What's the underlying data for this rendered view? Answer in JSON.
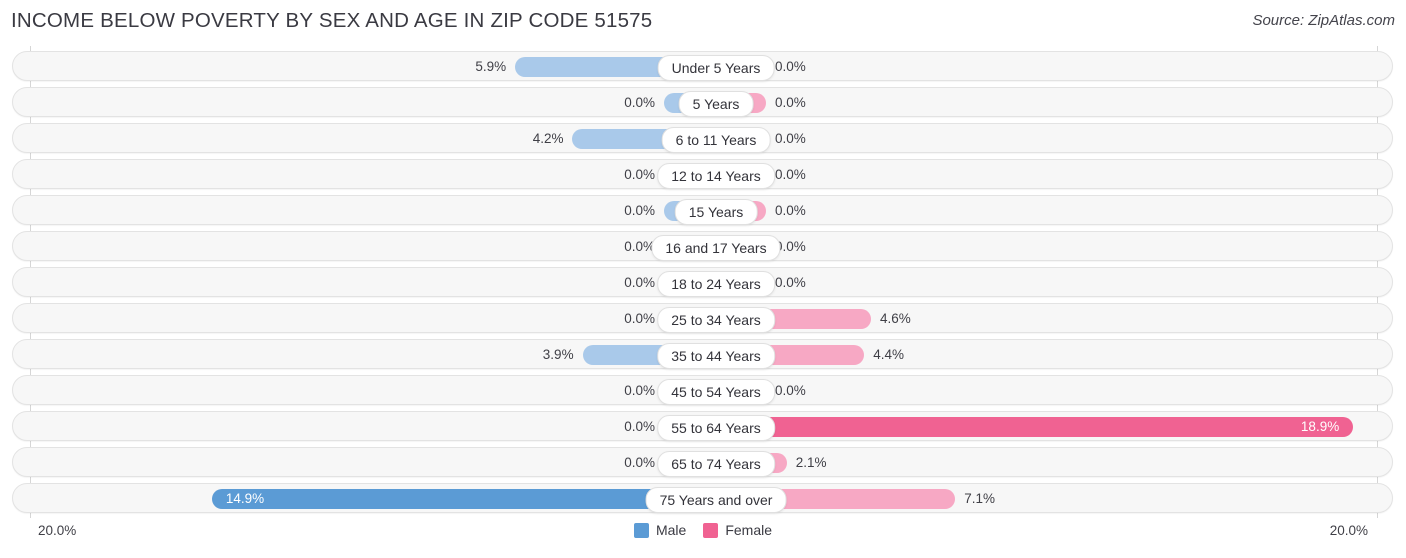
{
  "header": {
    "title": "INCOME BELOW POVERTY BY SEX AND AGE IN ZIP CODE 51575",
    "source": "Source: ZipAtlas.com"
  },
  "legend": {
    "male_label": "Male",
    "female_label": "Female",
    "male_color": "#5b9bd5",
    "female_color": "#f06292"
  },
  "axis": {
    "left_tick": "20.0%",
    "right_tick": "20.0%"
  },
  "colors": {
    "male_light": "#a9c9ea",
    "male_strong": "#5b9bd5",
    "female_light": "#f7a8c4",
    "female_strong": "#f06292",
    "row_background": "#f7f7f7",
    "row_border": "#e3e3e3"
  },
  "chart_data": {
    "type": "bar",
    "subtype": "diverging-bidirectional-bar",
    "title": "INCOME BELOW POVERTY BY SEX AND AGE IN ZIP CODE 51575",
    "source": "Source: ZipAtlas.com",
    "xlabel": "",
    "ylabel": "",
    "xlim": [
      -20.0,
      20.0
    ],
    "axis_max_percent": 20.0,
    "grid": false,
    "legend_position": "bottom-center",
    "categories": [
      "Under 5 Years",
      "5 Years",
      "6 to 11 Years",
      "12 to 14 Years",
      "15 Years",
      "16 and 17 Years",
      "18 to 24 Years",
      "25 to 34 Years",
      "35 to 44 Years",
      "45 to 54 Years",
      "55 to 64 Years",
      "65 to 74 Years",
      "75 Years and over"
    ],
    "series": [
      {
        "name": "Male",
        "direction": "left",
        "values": [
          5.9,
          0.0,
          4.2,
          0.0,
          0.0,
          0.0,
          0.0,
          0.0,
          3.9,
          0.0,
          0.0,
          0.0,
          14.9
        ],
        "labels": [
          "5.9%",
          "0.0%",
          "4.2%",
          "0.0%",
          "0.0%",
          "0.0%",
          "0.0%",
          "0.0%",
          "3.9%",
          "0.0%",
          "0.0%",
          "0.0%",
          "14.9%"
        ]
      },
      {
        "name": "Female",
        "direction": "right",
        "values": [
          0.0,
          0.0,
          0.0,
          0.0,
          0.0,
          0.0,
          0.0,
          4.6,
          4.4,
          0.0,
          18.9,
          2.1,
          7.1
        ],
        "labels": [
          "0.0%",
          "0.0%",
          "0.0%",
          "0.0%",
          "0.0%",
          "0.0%",
          "0.0%",
          "4.6%",
          "4.4%",
          "0.0%",
          "18.9%",
          "2.1%",
          "7.1%"
        ]
      }
    ]
  }
}
